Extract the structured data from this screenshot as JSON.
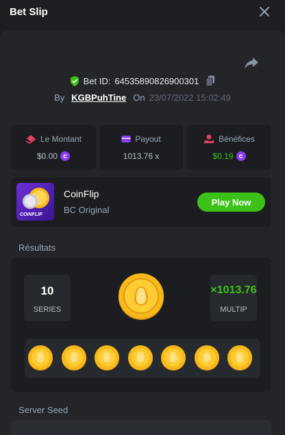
{
  "header": {
    "title": "Bet Slip"
  },
  "bet": {
    "id_label": "Bet ID:",
    "id_value": "64535890826900301",
    "by_label": "By",
    "user": "KGBPuhTine",
    "on_label": "On",
    "date": "23/07/2022 15:02:49"
  },
  "stats": {
    "amount": {
      "label": "Le Montant",
      "value": "$0.00"
    },
    "payout": {
      "label": "Payout",
      "value": "1013.76 x"
    },
    "profit": {
      "label": "Bénéfices",
      "value": "$0.19"
    }
  },
  "game": {
    "name": "CoinFlip",
    "subtitle": "BC Original",
    "thumb_label": "COINFLIP",
    "play_label": "Play Now"
  },
  "results": {
    "section_label": "Résultats",
    "series_value": "10",
    "series_label": "SERIES",
    "multiplier_value": "×1013.76",
    "multiplier_label": "MULTIP"
  },
  "server_seed": {
    "label": "Server Seed"
  },
  "colors": {
    "accent_green": "#3bc117",
    "bc_purple": "#8b3bf4",
    "coin_gold": "#f6b81a"
  },
  "icons": [
    "close-icon",
    "share-icon",
    "shield-check-icon",
    "copy-icon",
    "money-icon",
    "wallet-icon",
    "profit-icon",
    "bc-coin-icon",
    "gold-coin-icon"
  ]
}
